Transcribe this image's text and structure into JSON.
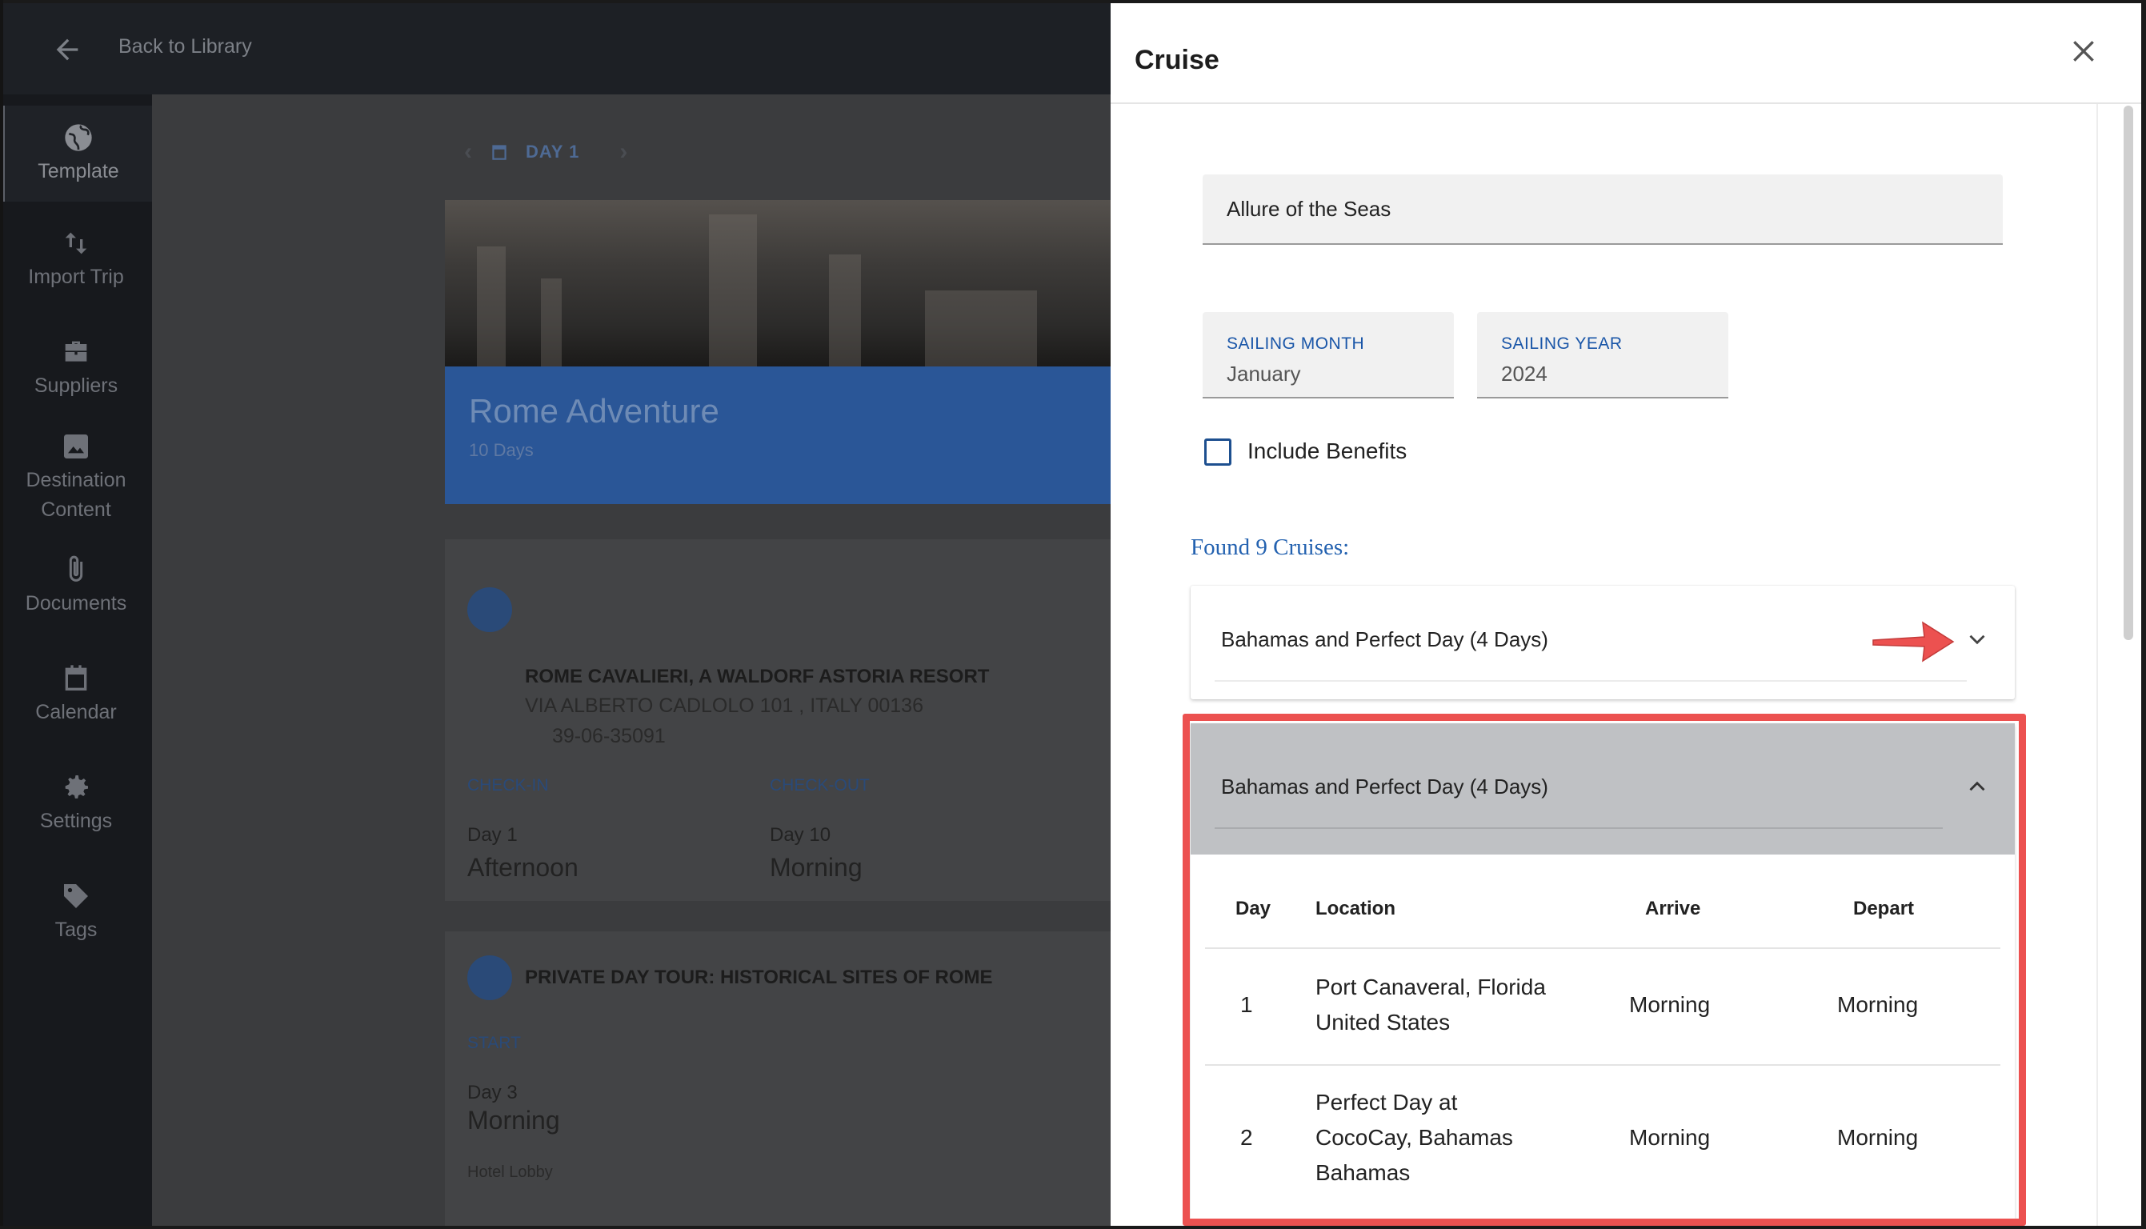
{
  "topbar": {
    "back_label": "Back to Library"
  },
  "sidebar": {
    "items": [
      {
        "label": "Template",
        "icon": "globe-icon"
      },
      {
        "label": "Import Trip",
        "icon": "import-arrows-icon"
      },
      {
        "label": "Suppliers",
        "icon": "briefcase-icon"
      },
      {
        "label_line1": "Destination",
        "label_line2": "Content",
        "icon": "image-icon"
      },
      {
        "label": "Documents",
        "icon": "paperclip-icon"
      },
      {
        "label": "Calendar",
        "icon": "calendar-icon"
      },
      {
        "label": "Settings",
        "icon": "gear-icon"
      },
      {
        "label": "Tags",
        "icon": "tag-icon"
      }
    ]
  },
  "day_nav": {
    "label": "DAY 1"
  },
  "hero": {
    "title": "Rome Adventure",
    "subtitle": "10 Days"
  },
  "hotel_card": {
    "name": "ROME CAVALIERI, A WALDORF ASTORIA RESORT",
    "address": "VIA ALBERTO CADLOLO 101 , ITALY 00136",
    "phone": "39-06-35091",
    "checkin_label": "CHECK-IN",
    "checkin_day": "Day 1",
    "checkin_time": "Afternoon",
    "checkout_label": "CHECK-OUT",
    "checkout_day": "Day 10",
    "checkout_time": "Morning"
  },
  "tour_card": {
    "name": "PRIVATE DAY TOUR: HISTORICAL SITES OF ROME",
    "start_label": "START",
    "start_day": "Day 3",
    "start_time": "Morning",
    "location": "Hotel Lobby"
  },
  "drawer": {
    "title": "Cruise",
    "ship_value": "Allure of the Seas",
    "month_label": "SAILING MONTH",
    "month_value": "January",
    "year_label": "SAILING YEAR",
    "year_value": "2024",
    "include_benefits_label": "Include Benefits",
    "include_benefits_checked": false,
    "found_text": "Found 9 Cruises:",
    "accordions": [
      {
        "title": "Bahamas and Perfect Day (4 Days)",
        "expanded": false
      },
      {
        "title": "Bahamas and Perfect Day (4 Days)",
        "expanded": true
      }
    ],
    "table": {
      "headers": {
        "day": "Day",
        "location": "Location",
        "arrive": "Arrive",
        "depart": "Depart"
      },
      "rows": [
        {
          "day": "1",
          "location_line1": "Port Canaveral, Florida",
          "location_line2": "United States",
          "arrive": "Morning",
          "depart": "Morning"
        },
        {
          "day": "2",
          "location_line1": "Perfect Day at",
          "location_line2": "CocoCay, Bahamas",
          "location_line3": "Bahamas",
          "arrive": "Morning",
          "depart": "Morning"
        }
      ]
    }
  },
  "colors": {
    "accent_blue": "#1a56a8",
    "annotation_red": "#ec5150",
    "accordion_expanded_bg": "#bfc1c4"
  }
}
